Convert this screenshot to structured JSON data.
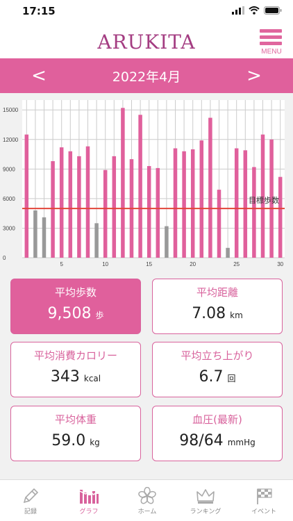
{
  "status": {
    "time": "17:15"
  },
  "header": {
    "logo": "ARUKITA",
    "menu_label": "MENU"
  },
  "month_nav": {
    "title": "2022年4月",
    "prev": "<",
    "next": ">"
  },
  "chart_data": {
    "type": "bar",
    "x": [
      1,
      2,
      3,
      4,
      5,
      6,
      7,
      8,
      9,
      10,
      11,
      12,
      13,
      14,
      15,
      16,
      17,
      18,
      19,
      20,
      21,
      22,
      23,
      24,
      25,
      26,
      27,
      28,
      29,
      30
    ],
    "values": [
      12500,
      4800,
      4100,
      9800,
      11200,
      10800,
      10300,
      11300,
      3500,
      8900,
      10300,
      15200,
      10000,
      14500,
      9300,
      9100,
      3200,
      11100,
      10800,
      11000,
      11900,
      14200,
      6900,
      1000,
      11100,
      10900,
      9200,
      12500,
      12000,
      8200
    ],
    "goal_met": [
      true,
      false,
      false,
      true,
      true,
      true,
      true,
      true,
      false,
      true,
      true,
      true,
      true,
      true,
      true,
      true,
      false,
      true,
      true,
      true,
      true,
      true,
      true,
      false,
      true,
      true,
      true,
      true,
      true,
      true
    ],
    "goal": 5000,
    "goal_label": "目標歩数",
    "ylim": [
      0,
      16000
    ],
    "yticks": [
      0,
      3000,
      6000,
      9000,
      12000,
      15000
    ],
    "xticks": [
      5,
      10,
      15,
      20,
      25,
      30
    ],
    "xlim": [
      0.5,
      30.5
    ],
    "grid": true,
    "colors": {
      "bar": "#e0609c",
      "bar_below_goal": "#999999",
      "goal_line": "#e2453a",
      "grid": "#cccccc"
    }
  },
  "stats": {
    "avg_steps": {
      "title": "平均歩数",
      "value": "9,508",
      "unit": "歩"
    },
    "avg_distance": {
      "title": "平均距離",
      "value": "7.08",
      "unit": "km"
    },
    "avg_calories": {
      "title": "平均消費カロリー",
      "value": "343",
      "unit": "kcal"
    },
    "avg_standups": {
      "title": "平均立ち上がり",
      "value": "6.7",
      "unit": "回"
    },
    "avg_weight": {
      "title": "平均体重",
      "value": "59.0",
      "unit": "kg"
    },
    "blood_pressure": {
      "title": "血圧(最新)",
      "value": "98/64",
      "unit": "mmHg"
    }
  },
  "tabs": [
    {
      "label": "記録",
      "icon": "pencil-icon"
    },
    {
      "label": "グラフ",
      "icon": "bar-chart-icon"
    },
    {
      "label": "ホーム",
      "icon": "flower-icon"
    },
    {
      "label": "ランキング",
      "icon": "crown-icon"
    },
    {
      "label": "イベント",
      "icon": "checkered-flag-icon"
    }
  ],
  "colors": {
    "brand": "#e0609c",
    "brand_dark": "#a43d82"
  }
}
